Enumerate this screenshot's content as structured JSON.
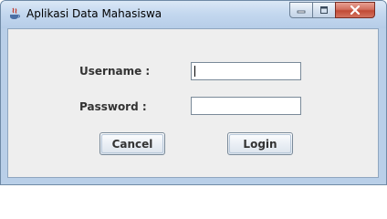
{
  "window": {
    "title": "Aplikasi Data Mahasiswa",
    "controls": {
      "minimize": "minimize-icon",
      "maximize": "maximize-icon",
      "close": "close-icon"
    }
  },
  "form": {
    "username_label": "Username :",
    "username_value": "",
    "password_label": "Password  :",
    "password_value": ""
  },
  "buttons": {
    "cancel_label": "Cancel",
    "login_label": "Login"
  },
  "colors": {
    "title_bar": "#c4d8ef",
    "client_bg": "#eeeeee",
    "close_button": "#c14a35"
  }
}
